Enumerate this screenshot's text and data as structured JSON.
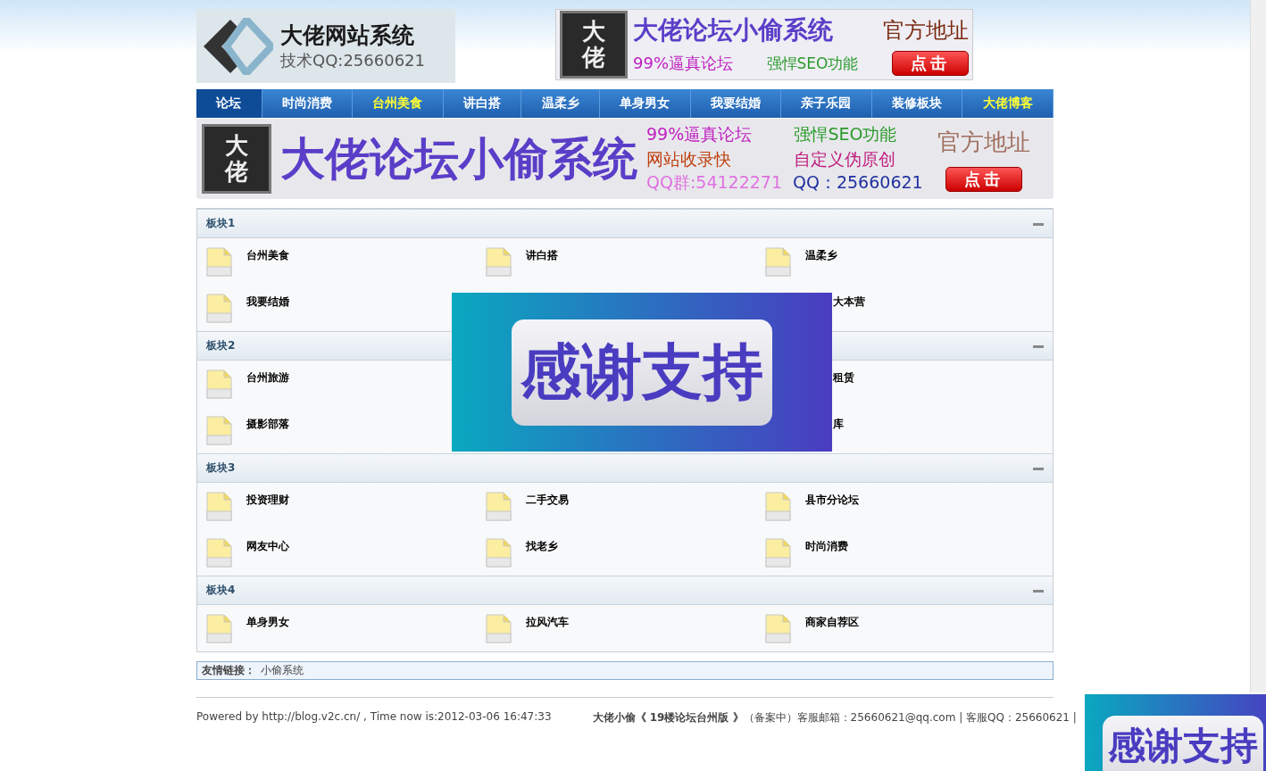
{
  "header": {
    "logo": {
      "title": "大佬网站系统",
      "subtitle": "技术QQ:25660621"
    },
    "ad": {
      "seal": "大佬",
      "title": "大佬论坛小偷系统",
      "official": "官方地址",
      "tagline_1": "99%逼真论坛",
      "tagline_2": "强悍SEO功能",
      "button": "点击"
    }
  },
  "nav": [
    {
      "label": "论坛",
      "selected": true,
      "highlight": false
    },
    {
      "label": "时尚消费",
      "selected": false,
      "highlight": false
    },
    {
      "label": "台州美食",
      "selected": false,
      "highlight": true
    },
    {
      "label": "讲白搭",
      "selected": false,
      "highlight": false
    },
    {
      "label": "温柔乡",
      "selected": false,
      "highlight": false
    },
    {
      "label": "单身男女",
      "selected": false,
      "highlight": false
    },
    {
      "label": "我要结婚",
      "selected": false,
      "highlight": false
    },
    {
      "label": "亲子乐园",
      "selected": false,
      "highlight": false
    },
    {
      "label": "装修板块",
      "selected": false,
      "highlight": false
    },
    {
      "label": "大佬博客",
      "selected": false,
      "highlight": true
    }
  ],
  "banner": {
    "seal": "大佬",
    "title": "大佬论坛小偷系统",
    "lines": [
      "99%逼真论坛",
      "强悍SEO功能",
      "网站收录快",
      "自定义伪原创"
    ],
    "qq_group": "QQ群:54122271",
    "qq": "QQ：25660621",
    "official": "官方地址",
    "button": "点击"
  },
  "sections": [
    {
      "title": "板块1",
      "expanded": true,
      "forums": [
        {
          "name": "台州美食",
          "kind": "full"
        },
        {
          "name": "讲白搭",
          "kind": "full"
        },
        {
          "name": "温柔乡",
          "kind": "full"
        },
        {
          "name": "我要结婚",
          "kind": "full"
        },
        {
          "name": "大本营",
          "kind": "clipped"
        }
      ]
    },
    {
      "title": "板块2",
      "expanded": true,
      "forums": [
        {
          "name": "台州旅游",
          "kind": "full"
        },
        {
          "name": "租赁",
          "kind": "clipped"
        },
        {
          "name": "摄影部落",
          "kind": "full"
        },
        {
          "name": "库",
          "kind": "clipped"
        }
      ]
    },
    {
      "title": "板块3",
      "expanded": true,
      "forums": [
        {
          "name": "投资理财",
          "kind": "full"
        },
        {
          "name": "二手交易",
          "kind": "full"
        },
        {
          "name": "县市分论坛",
          "kind": "full"
        },
        {
          "name": "网友中心",
          "kind": "full"
        },
        {
          "name": "找老乡",
          "kind": "full"
        },
        {
          "name": "时尚消费",
          "kind": "full"
        }
      ]
    },
    {
      "title": "板块4",
      "expanded": true,
      "forums": [
        {
          "name": "单身男女",
          "kind": "full"
        },
        {
          "name": "拉风汽车",
          "kind": "full"
        },
        {
          "name": "商家自荐区",
          "kind": "full"
        }
      ]
    }
  ],
  "links": {
    "label": "友情链接：",
    "items": [
      "小偷系统"
    ]
  },
  "footer": {
    "powered": "Powered by http://blog.v2c.cn/ , Time now is:2012-03-06 16:47:33",
    "info": "**大佬小偷《 19楼论坛台州版 》**（备案中）客服邮箱：25660621@qq.com | 客服QQ：25660621 |"
  },
  "popups": [
    {
      "text": "感谢支持"
    },
    {
      "text": "感谢支持"
    }
  ]
}
